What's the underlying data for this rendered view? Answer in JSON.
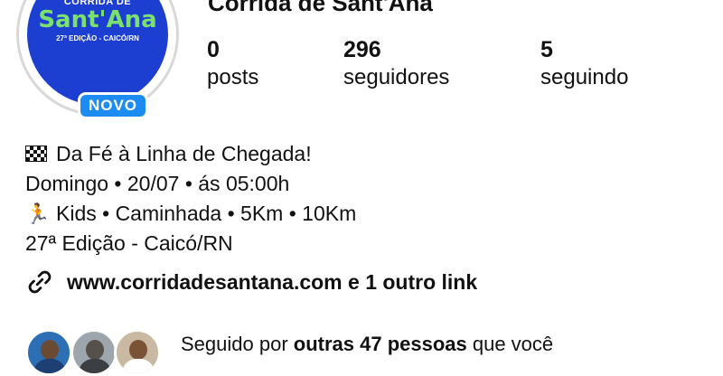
{
  "profile": {
    "name": "Corrida de Sant'Ana",
    "badge": "NOVO",
    "logo": {
      "line1": "CORRIDA DE",
      "line2": "Sant'Ana",
      "line3": "27ª EDIÇÃO - CAICÓ/RN",
      "color": "#1c3fd1",
      "accent": "#7be06f"
    }
  },
  "stats": [
    {
      "value": "0",
      "label": "posts"
    },
    {
      "value": "296",
      "label": "seguidores"
    },
    {
      "value": "5",
      "label": "seguindo"
    }
  ],
  "bio": {
    "line1": "Da Fé à Linha de Chegada!",
    "line1_icon": "checkered-flag-icon",
    "line2": "Domingo • 20/07 • ás 05:00h",
    "line3": "Kids • Caminhada • 5Km • 10Km",
    "line3_icon": "runner-icon",
    "line4": "27ª Edição - Caicó/RN"
  },
  "link": {
    "icon": "link-icon",
    "text": "www.corridadesantana.com e 1 outro link"
  },
  "followed_by": {
    "prefix": "Seguido por ",
    "bold": "outras 47 pessoas",
    "suffix": " que você"
  },
  "colors": {
    "badge": "#1d8cf2",
    "text": "#111111"
  }
}
